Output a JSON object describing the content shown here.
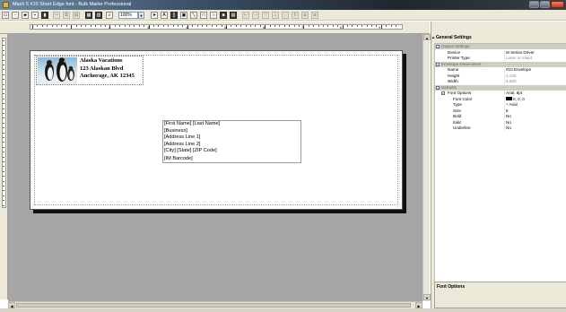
{
  "window": {
    "title": "Mach 5 #10 Short Edge font - Bulk Mailer Professional"
  },
  "toolbar": {
    "zoom": "100%"
  },
  "ruler": {
    "numbers": [
      "1",
      "2",
      "3",
      "4",
      "5",
      "6",
      "7",
      "8",
      "9"
    ]
  },
  "envelope": {
    "return_address": [
      "Alaska Vacations",
      "123 Alaskan Blvd",
      "Anchorage, AK 12345"
    ],
    "address_block": [
      "[First Name] [Last Name]",
      "[Business]",
      "[Address Line 1]",
      "[Address Line 2]",
      "[City] [State] [ZIP Code]"
    ],
    "barcode": "[IM Barcode]"
  },
  "panel": {
    "title": "General Settings",
    "output_settings": {
      "label": "Output Settings",
      "device_label": "Device",
      "device_value": "M Series Driver",
      "printer_type_label": "Printer Type",
      "printer_type_value": "Laser or Inkjet"
    },
    "envelope_dimensions": {
      "label": "Envelope Dimensions",
      "name_label": "Name",
      "name_value": "#10 Envelope",
      "height_label": "Height",
      "height_value": "4.125",
      "width_label": "Width",
      "width_value": "9.500"
    },
    "defaults": {
      "label": "Defaults",
      "font_options_label": "Font Options",
      "font_options_value": "Arial, 8pt",
      "font_color_label": "Font Color",
      "font_color_value": "0, 0, 0",
      "type_label": "Type",
      "type_value": "Arial",
      "size_label": "Size",
      "size_value": "8",
      "bold_label": "Bold",
      "bold_value": "No",
      "italic_label": "Italic",
      "italic_value": "No",
      "underline_label": "Underline",
      "underline_value": "No"
    },
    "description_title": "Font Options"
  },
  "colors": {
    "font_color": "#000000"
  }
}
